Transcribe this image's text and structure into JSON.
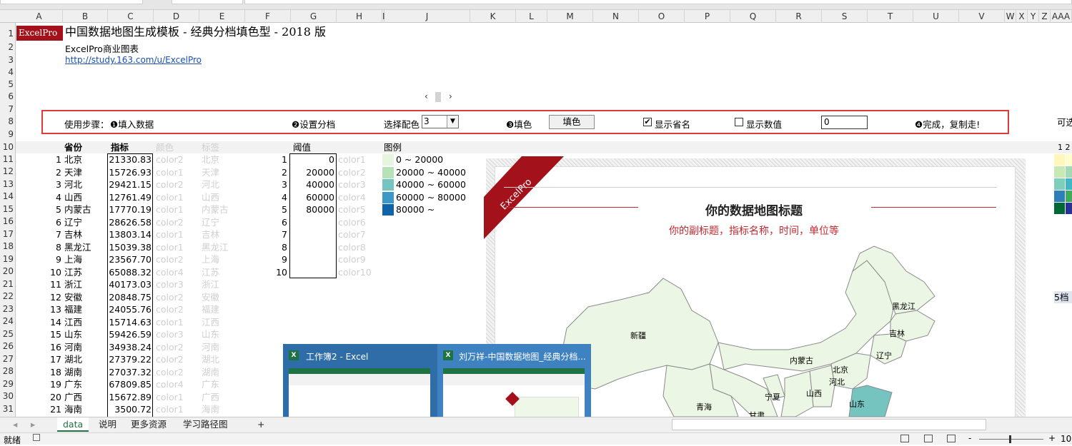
{
  "sheet": {
    "columns": [
      "A",
      "B",
      "C",
      "D",
      "E",
      "F",
      "G",
      "H",
      "I",
      "J",
      "K",
      "L",
      "M",
      "N",
      "O",
      "P",
      "Q",
      "R",
      "S",
      "T",
      "U",
      "V",
      "W",
      "X",
      "Y",
      "Z",
      "AAA"
    ],
    "rows": [
      "1",
      "2",
      "3",
      "4",
      "5",
      "6",
      "7",
      "8",
      "9",
      "10",
      "11",
      "12",
      "13",
      "14",
      "15",
      "16",
      "17",
      "18",
      "19",
      "20",
      "21",
      "22",
      "23",
      "24",
      "25",
      "26",
      "27",
      "28",
      "29",
      "30",
      "31"
    ]
  },
  "header": {
    "logo": "ExcelPro",
    "title": "中国数据地图生成模板  -  经典分档填色型  -  2018  版",
    "subtitle": "ExcelPro商业图表",
    "link": "http://study.163.com/u/ExcelPro"
  },
  "steps": {
    "label": "使用步骤：",
    "step1": "❶填入数据",
    "step2": "❷设置分档",
    "color_label": "选择配色",
    "color_value": "3",
    "step3": "❸填色",
    "fill_button": "填色",
    "show_province": "显示省名",
    "show_province_checked": "✔",
    "show_value": "显示数值",
    "value_input": "0",
    "step4": "❹完成，复制走!"
  },
  "table_headers": {
    "province": "省份",
    "indicator": "指标",
    "color": "颜色",
    "tag": "标签",
    "threshold": "阈值",
    "legend": "图例"
  },
  "provinces": [
    {
      "no": "1",
      "name": "北京",
      "value": "21330.83",
      "color": "color2",
      "tag": "北京"
    },
    {
      "no": "2",
      "name": "天津",
      "value": "15726.93",
      "color": "color1",
      "tag": "天津"
    },
    {
      "no": "3",
      "name": "河北",
      "value": "29421.15",
      "color": "color2",
      "tag": "河北"
    },
    {
      "no": "4",
      "name": "山西",
      "value": "12761.49",
      "color": "color1",
      "tag": "山西"
    },
    {
      "no": "5",
      "name": "内蒙古",
      "value": "17770.19",
      "color": "color1",
      "tag": "内蒙古"
    },
    {
      "no": "6",
      "name": "辽宁",
      "value": "28626.58",
      "color": "color2",
      "tag": "辽宁"
    },
    {
      "no": "7",
      "name": "吉林",
      "value": "13803.14",
      "color": "color1",
      "tag": "吉林"
    },
    {
      "no": "8",
      "name": "黑龙江",
      "value": "15039.38",
      "color": "color1",
      "tag": "黑龙江"
    },
    {
      "no": "9",
      "name": "上海",
      "value": "23567.70",
      "color": "color2",
      "tag": "上海"
    },
    {
      "no": "10",
      "name": "江苏",
      "value": "65088.32",
      "color": "color4",
      "tag": "江苏"
    },
    {
      "no": "11",
      "name": "浙江",
      "value": "40173.03",
      "color": "color3",
      "tag": "浙江"
    },
    {
      "no": "12",
      "name": "安徽",
      "value": "20848.75",
      "color": "color2",
      "tag": "安徽"
    },
    {
      "no": "13",
      "name": "福建",
      "value": "24055.76",
      "color": "color2",
      "tag": "福建"
    },
    {
      "no": "14",
      "name": "江西",
      "value": "15714.63",
      "color": "color1",
      "tag": "江西"
    },
    {
      "no": "15",
      "name": "山东",
      "value": "59426.59",
      "color": "color3",
      "tag": "山东"
    },
    {
      "no": "16",
      "name": "河南",
      "value": "34938.24",
      "color": "color2",
      "tag": "河南"
    },
    {
      "no": "17",
      "name": "湖北",
      "value": "27379.22",
      "color": "color2",
      "tag": "湖北"
    },
    {
      "no": "18",
      "name": "湖南",
      "value": "27037.32",
      "color": "color2",
      "tag": "湖南"
    },
    {
      "no": "19",
      "name": "广东",
      "value": "67809.85",
      "color": "color4",
      "tag": "广东"
    },
    {
      "no": "20",
      "name": "广西",
      "value": "15672.89",
      "color": "color1",
      "tag": "广西"
    },
    {
      "no": "21",
      "name": "海南",
      "value": "3500.72",
      "color": "color1",
      "tag": "海南"
    }
  ],
  "thresholds": [
    {
      "no": "1",
      "value": "0",
      "color": "color1"
    },
    {
      "no": "2",
      "value": "20000",
      "color": "color2"
    },
    {
      "no": "3",
      "value": "40000",
      "color": "color3"
    },
    {
      "no": "4",
      "value": "60000",
      "color": "color4"
    },
    {
      "no": "5",
      "value": "80000",
      "color": "color5"
    },
    {
      "no": "6",
      "value": "",
      "color": "color6"
    },
    {
      "no": "7",
      "value": "",
      "color": "color7"
    },
    {
      "no": "8",
      "value": "",
      "color": "color8"
    },
    {
      "no": "9",
      "value": "",
      "color": "color9"
    },
    {
      "no": "10",
      "value": "",
      "color": "color10"
    }
  ],
  "legend": [
    {
      "label": "0 ~ 20000",
      "color": "#e8f5de"
    },
    {
      "label": "20000 ~ 40000",
      "color": "#b7e1b8"
    },
    {
      "label": "40000 ~ 60000",
      "color": "#76c4c0"
    },
    {
      "label": "60000 ~ 80000",
      "color": "#3b98c7"
    },
    {
      "label": "80000 ~",
      "color": "#0f63a8"
    }
  ],
  "map": {
    "ribbon": "ExcelPro",
    "title": "你的数据地图标题",
    "subtitle": "你的副标题，指标名称，时间，单位等",
    "labels": {
      "xinjiang": "新疆",
      "heilongjiang": "黑龙江",
      "jilin": "吉林",
      "liaoning": "辽宁",
      "neimenggu": "内蒙古",
      "beijing": "北京",
      "hebei": "河北",
      "shanxi": "山西",
      "ningxia": "宁夏",
      "qinghai": "青海",
      "gansu": "甘肃",
      "shandong": "山东"
    }
  },
  "right_pane": {
    "top_text": "可选",
    "digits": "1 2",
    "tier_label": "5档"
  },
  "taskbar_popup": {
    "item1": "工作簿2 - Excel",
    "item2": "刘万祥-中国数据地图_经典分档...",
    "excel_badge": "X"
  },
  "tabs": {
    "items": [
      "data",
      "说明",
      "更多资源",
      "学习路径图"
    ],
    "add": "+"
  },
  "status": {
    "ready": "就绪",
    "zoom_minus": "-",
    "zoom_plus": "+",
    "zoom": "10"
  },
  "colors": {
    "accent_red": "#c0282f",
    "logo_bg": "#a3121b",
    "popup_bg": "#2e6da8"
  }
}
